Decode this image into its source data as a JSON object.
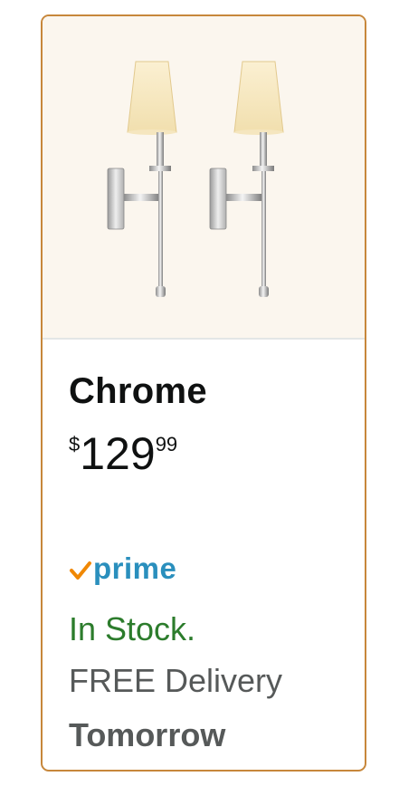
{
  "product": {
    "image_alt": "two chrome wall sconces with white shades",
    "title": "Chrome",
    "price": {
      "currency_symbol": "$",
      "whole": "129",
      "fraction": "99"
    },
    "prime": {
      "icon": "prime-check-icon",
      "label": "prime"
    },
    "stock_status": "In Stock.",
    "delivery_label": "FREE Delivery",
    "delivery_date": "Tomorrow"
  },
  "colors": {
    "card_border": "#c7873b",
    "image_background": "#fbf6ee",
    "stock_green": "#2c7c2c",
    "prime_blue": "#2a8fbd",
    "prime_check_orange": "#f08804",
    "muted_text": "#565959"
  }
}
